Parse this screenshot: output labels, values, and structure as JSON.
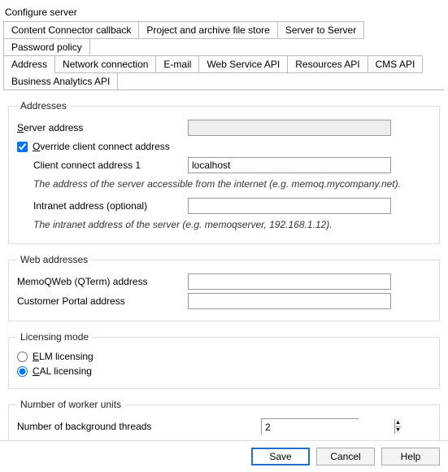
{
  "title": "Configure server",
  "tabs_row1": [
    "Content Connector callback",
    "Project and archive file store",
    "Server to Server",
    "Password policy"
  ],
  "tabs_row2": [
    "Address",
    "Network connection",
    "E-mail",
    "Web Service API",
    "Resources API",
    "CMS API",
    "Business Analytics API"
  ],
  "active_tab": "Address",
  "groups": {
    "addresses": {
      "legend": "Addresses",
      "server_address_label": "Server address",
      "server_address_value": "",
      "override_label": "Override client connect address",
      "override_checked": true,
      "client_addr_label": "Client connect address 1",
      "client_addr_value": "localhost",
      "client_hint": "The address of the server accessible from the internet (e.g. memoq.mycompany.net).",
      "intranet_label": "Intranet address (optional)",
      "intranet_value": "",
      "intranet_hint": "The intranet address of the server (e.g. memoqserver, 192.168.1.12)."
    },
    "web": {
      "legend": "Web addresses",
      "qterm_label": "MemoQWeb (QTerm) address",
      "qterm_value": "",
      "portal_label": "Customer Portal address",
      "portal_value": ""
    },
    "licensing": {
      "legend": "Licensing mode",
      "elm_label": "ELM licensing",
      "cal_label": "CAL licensing",
      "selected": "cal"
    },
    "workers": {
      "legend": "Number of worker units",
      "threads_label": "Number of background threads",
      "threads_value": "2"
    }
  },
  "buttons": {
    "save": "Save",
    "cancel": "Cancel",
    "help": "Help"
  }
}
